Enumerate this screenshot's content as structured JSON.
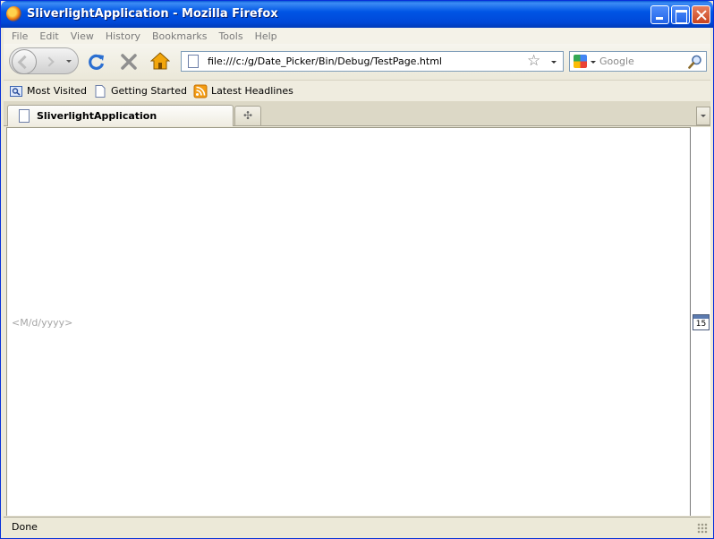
{
  "window": {
    "title": "SliverlightApplication - Mozilla Firefox"
  },
  "menu": {
    "items": [
      "File",
      "Edit",
      "View",
      "History",
      "Bookmarks",
      "Tools",
      "Help"
    ]
  },
  "navbar": {
    "url": "file:///c:/g/Date_Picker/Bin/Debug/TestPage.html",
    "search_placeholder": "Google",
    "search_engine_icon": "google-icon"
  },
  "bookmarks": {
    "items": [
      {
        "label": "Most Visited",
        "icon": "most-visited-icon"
      },
      {
        "label": "Getting Started",
        "icon": "page-icon"
      },
      {
        "label": "Latest Headlines",
        "icon": "rss-icon"
      }
    ]
  },
  "tabs": {
    "items": [
      {
        "label": "SliverlightApplication",
        "icon": "page-icon"
      }
    ],
    "new_tab_glyph": "✣"
  },
  "content": {
    "date_placeholder": "<M/d/yyyy>",
    "calendar_day": "15"
  },
  "statusbar": {
    "text": "Done"
  },
  "colors": {
    "titlebar": "#0055e5",
    "chrome": "#ece9d8",
    "reload_blue": "#2b6fd1",
    "home_orange": "#f2a60b"
  }
}
